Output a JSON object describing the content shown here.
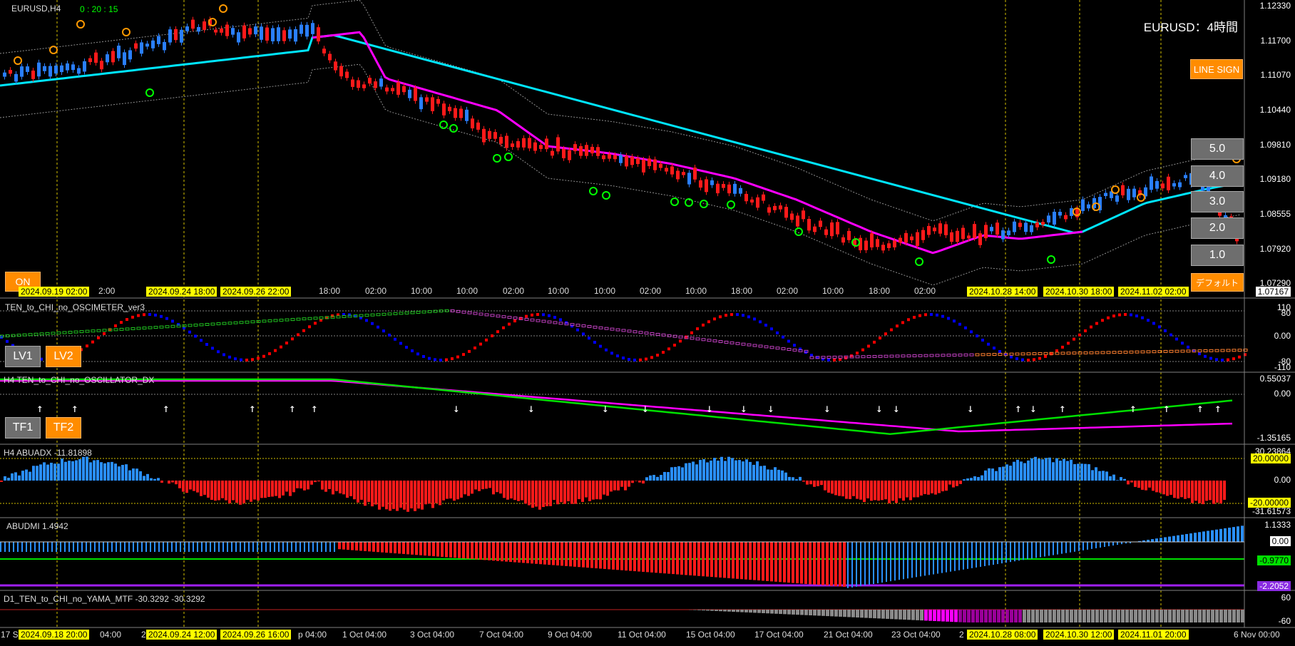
{
  "colors": {
    "bull": "#2a7fff",
    "bear": "#ff1a1a",
    "ma_fast": "#00e5ff",
    "ma_slow": "#ff00ff",
    "grid": "#d4c000",
    "orange_btn": "#ff8c00",
    "gray_btn": "#6e6e6e",
    "green": "#00e000"
  },
  "main": {
    "symbol_label": "EURUSD,H4",
    "timer": "0 : 20 : 15",
    "title": "EURUSD：4時間",
    "price_axis": [
      "1.12330",
      "1.11700",
      "1.11070",
      "1.10440",
      "1.09810",
      "1.09180",
      "1.08555",
      "1.07920",
      "1.07290"
    ],
    "current_price": "1.07167",
    "line_sign_button": "LINE SIGN",
    "on_button": "ON",
    "default_button": "デフォルト",
    "level_buttons": [
      "5.0",
      "4.0",
      "3.0",
      "2.0",
      "1.0"
    ],
    "time_labels": [
      "2:00",
      "18:00",
      "02:00",
      "10:00",
      "10:00",
      "02:00",
      "10:00",
      "10:00",
      "02:00",
      "10:00",
      "18:00",
      "02:00",
      "10:00",
      "18:00",
      "02:00"
    ],
    "date_highlights": [
      "2024.09.19 02:00",
      "2024.09.24 18:00",
      "2024.09.26 22:00",
      "2024.10.28 14:00",
      "2024.10.30 18:00",
      "2024.11.02 02:00"
    ]
  },
  "osc1": {
    "label": "TEN_to_CHI_no_OSCIMETER_ver3",
    "axis": [
      "110",
      "80",
      "0.00",
      "-80",
      "-110"
    ],
    "lv1": "LV1",
    "lv2": "LV2",
    "markers": [
      "1",
      "3",
      "1",
      "2",
      "2",
      "1",
      "5",
      "2",
      "5",
      "1"
    ]
  },
  "osc2": {
    "label": "H4 TEN_to_CHI_no_OSCILLATOR_DX",
    "axis": [
      "0.55037",
      "0.00",
      "-1.35165"
    ],
    "tf1": "TF1",
    "tf2": "TF2"
  },
  "abuadx": {
    "label": "H4 ABUADX -11.81898",
    "axis": [
      "30.23864",
      "20.00000",
      "0.00",
      "-20.00000",
      "-31.61573"
    ]
  },
  "abudmi": {
    "label": "ABUDMI  1.4942",
    "axis": [
      "1.1333",
      "0.00",
      "-0.9770",
      "-2.2052"
    ]
  },
  "yama": {
    "label": "D1_TEN_to_CHI_no_YAMA_MTF -30.3292 -30.3292",
    "axis": [
      "60",
      "-60"
    ]
  },
  "bottom_axis": {
    "labels": [
      "17 S",
      "04:00",
      "2",
      "p 04:00",
      "1 Oct 04:00",
      "3 Oct 04:00",
      "7 Oct 04:00",
      "9 Oct 04:00",
      "11 Oct 04:00",
      "15 Oct 04:00",
      "17 Oct 04:00",
      "21 Oct 04:00",
      "23 Oct 04:00",
      "2",
      "6 Nov 00:00"
    ],
    "date_highlights": [
      "2024.09.18 20:00",
      "2024.09.24 12:00",
      "2024.09.26 16:00",
      "2024.10.28 08:00",
      "2024.10.30 12:00",
      "2024.11.01 20:00"
    ]
  }
}
